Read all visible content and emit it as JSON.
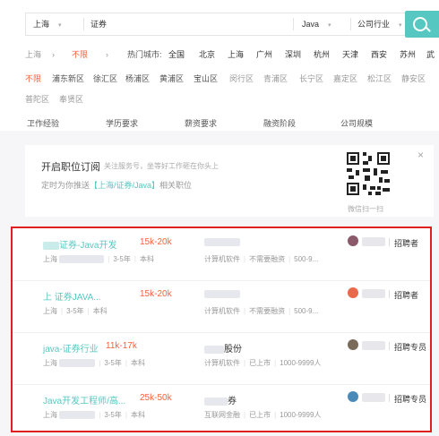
{
  "search": {
    "city": "上海",
    "keyword": "证券",
    "language": "Java",
    "industry": "公司行业"
  },
  "city_row": {
    "current": "上海",
    "selected": "不限",
    "hot_label": "热门城市:",
    "cities": [
      "全国",
      "北京",
      "上海",
      "广州",
      "深圳",
      "杭州",
      "天津",
      "西安",
      "苏州",
      "武"
    ]
  },
  "districts": [
    "不限",
    "浦东新区",
    "徐汇区",
    "杨浦区",
    "黄浦区",
    "宝山区",
    "闵行区",
    "青浦区",
    "长宁区",
    "嘉定区",
    "松江区",
    "静安区"
  ],
  "districts2": [
    "普陀区",
    "奉贤区"
  ],
  "filters": [
    "工作经验",
    "学历要求",
    "薪资要求",
    "融资阶段",
    "公司规模"
  ],
  "subscribe": {
    "title": "开启职位订阅",
    "hint": "关注服务号，坐等好工作砸在你头上",
    "line_prefix": "定时为你推送",
    "line_highlight": "【上海/证券/Java】",
    "line_suffix": "相关职位",
    "qr_label": "微信扫一扫"
  },
  "jobs": [
    {
      "title": "证券-Java开发",
      "salary": "15k-20k",
      "meta_city": "上海",
      "meta_exp": "3-5年",
      "meta_edu": "本科",
      "company": "",
      "cinfo": [
        "计算机软件",
        "不需要融资",
        "500-9..."
      ],
      "role": "招聘者",
      "avatar_color": "#8a5a6a"
    },
    {
      "title": "上 证券JAVA...",
      "salary": "15k-20k",
      "meta_city": "上海",
      "meta_exp": "3-5年",
      "meta_edu": "本科",
      "company": "",
      "cinfo": [
        "计算机软件",
        "不需要融资",
        "500-9..."
      ],
      "role": "招聘者",
      "avatar_color": "#e86a4a"
    },
    {
      "title": "java-证券行业",
      "salary": "11k-17k",
      "meta_city": "上海",
      "meta_exp": "3-5年",
      "meta_edu": "本科",
      "company": "股份",
      "cinfo": [
        "计算机软件",
        "已上市",
        "1000-9999人"
      ],
      "role": "招聘专员",
      "avatar_color": "#7a6a5a"
    },
    {
      "title": "Java开发工程师/高...",
      "salary": "25k-50k",
      "meta_city": "上海",
      "meta_exp": "3-5年",
      "meta_edu": "本科",
      "company": "券",
      "cinfo": [
        "互联网金融",
        "已上市",
        "1000-9999人"
      ],
      "role": "招聘专员",
      "avatar_color": "#4a8ab8"
    }
  ],
  "colors": {
    "accent": "#56c8c1",
    "salary": "#fd5f39",
    "highlight_border": "#e02020"
  }
}
